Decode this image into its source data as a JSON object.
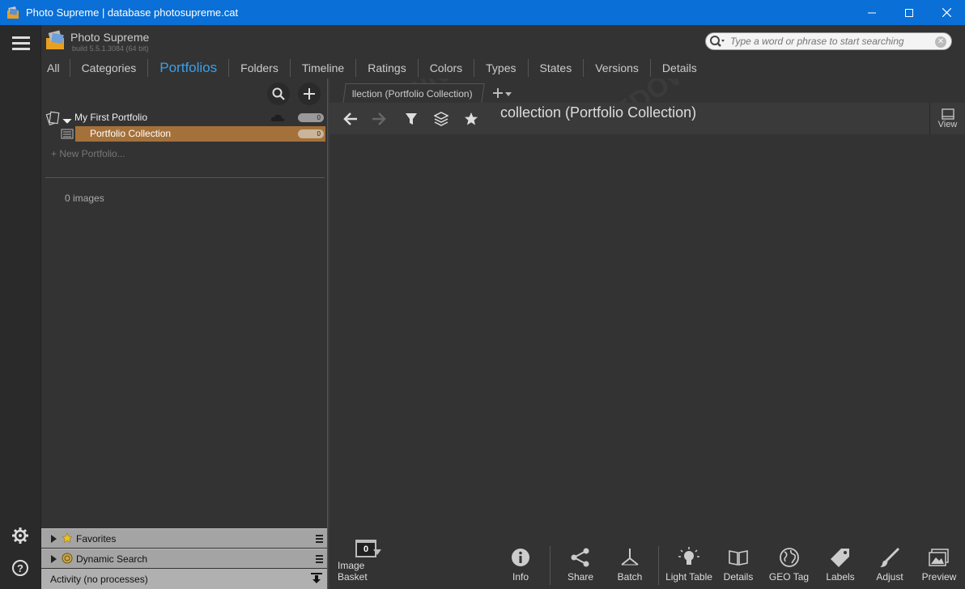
{
  "window": {
    "title": "Photo Supreme | database photosupreme.cat"
  },
  "app": {
    "name": "Photo Supreme",
    "build": "build 5.5.1.3084 (64 bit)"
  },
  "search": {
    "placeholder": "Type a word or phrase to start searching"
  },
  "nav": {
    "tabs": [
      {
        "label": "All"
      },
      {
        "label": "Categories"
      },
      {
        "label": "Portfolios"
      },
      {
        "label": "Folders"
      },
      {
        "label": "Timeline"
      },
      {
        "label": "Ratings"
      },
      {
        "label": "Colors"
      },
      {
        "label": "Types"
      },
      {
        "label": "States"
      },
      {
        "label": "Versions"
      },
      {
        "label": "Details"
      }
    ],
    "active": "Portfolios"
  },
  "tree": {
    "portfolio_label": "My First Portfolio",
    "portfolio_count": "0",
    "collection_label": "Portfolio Collection",
    "collection_count": "0",
    "new_portfolio": "+ New Portfolio...",
    "image_count": "0 images"
  },
  "panels": {
    "favorites": "Favorites",
    "dynamic_search": "Dynamic Search",
    "activity": "Activity (no processes)"
  },
  "doc": {
    "tab_label": "llection (Portfolio Collection)",
    "title": "collection (Portfolio Collection)",
    "view_label": "View"
  },
  "bottombar": {
    "basket_count": "0",
    "basket_label": "Image Basket",
    "info": "Info",
    "share": "Share",
    "batch": "Batch",
    "light_table": "Light Table",
    "details": "Details",
    "geo_tag": "GEO Tag",
    "labels": "Labels",
    "adjust": "Adjust",
    "preview": "Preview"
  },
  "colors": {
    "titlebar": "#0a6fd6",
    "accent": "#3aa0e8",
    "selection": "#a5713a"
  }
}
